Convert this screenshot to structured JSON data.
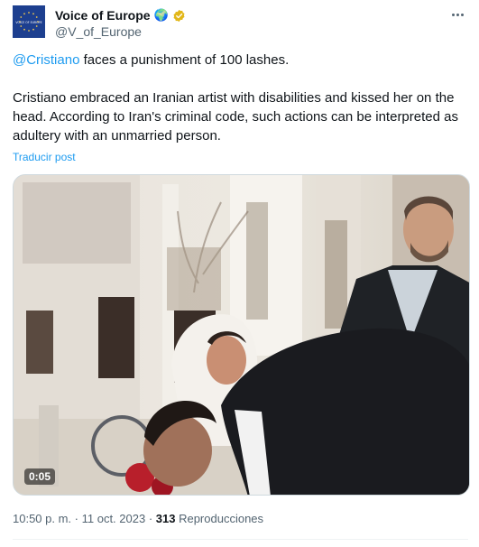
{
  "author": {
    "display_name": "Voice of Europe",
    "globe_emoji": "🌍",
    "handle": "@V_of_Europe",
    "avatar_text": "VOICE OF EUROPE",
    "avatar_color": "#1d3f8f",
    "verified_color": "#e2b719"
  },
  "tweet": {
    "mention": "@Cristiano",
    "line1_rest": " faces a punishment of 100 lashes.",
    "body": "Cristiano embraced an Iranian artist with disabilities and kissed her on the head. According to Iran's criminal code, such actions can be interpreted as adultery with an unmarried person.",
    "translate_label": "Traducir post"
  },
  "media": {
    "duration": "0:05"
  },
  "meta": {
    "time": "10:50 p. m.",
    "separator": " · ",
    "date": "11 oct. 2023",
    "separator2": " · ",
    "views_count": "313",
    "views_label": " Reproducciones"
  },
  "colors": {
    "link": "#1d9bf0",
    "secondary_text": "#536471",
    "primary_text": "#0f1419"
  }
}
